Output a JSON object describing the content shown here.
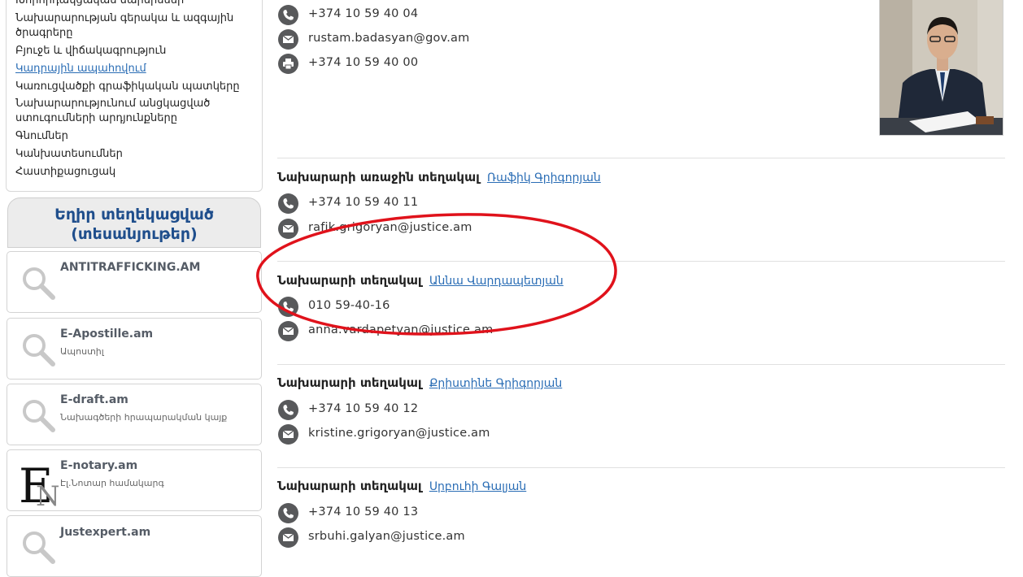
{
  "sidebar": {
    "menu": [
      "Խորհրդակցական մարմիններ",
      "Նախարարության գերակա և ազգային",
      "ծրագրերը",
      "Բյուջե և վիճակագրություն",
      "Կադրային ապահովում",
      "Կառուցվածքի գրաֆիկական պատկերը",
      "Նախարարությունում անցկացված",
      "ստուգումների արդյունքները",
      "Գնումներ",
      "Կանխատեսումներ",
      "Հաստիքացուցակ"
    ],
    "sites_heading_line1": "Եղիր տեղեկացված",
    "sites_heading_line2": "(տեսանյութեր)",
    "sites": [
      {
        "title": "ANTITRAFFICKING.AM",
        "sub": "",
        "icon": "search-icon"
      },
      {
        "title": "E-Apostille.am",
        "sub": "Ապոստիլ",
        "icon": "search-icon"
      },
      {
        "title": "E-draft.am",
        "sub": "Նախագծերի հրապարակման կայք",
        "icon": "search-icon"
      },
      {
        "title": "E-notary.am",
        "sub": "Էլ.Նոտար համակարգ",
        "icon": "en-logo"
      },
      {
        "title": "Justexpert.am",
        "sub": "",
        "icon": "search-icon"
      }
    ]
  },
  "contacts": {
    "minister": {
      "phone": "+374 10 59 40 04",
      "email": "rustam.badasyan@gov.am",
      "fax": "+374 10 59 40 00"
    },
    "deputies": [
      {
        "role": "Նախարարի առաջին տեղակալ",
        "name": "Ռաֆիկ Գրիգորյան",
        "phone": "+374 10 59 40 11",
        "email": "rafik.grigoryan@justice.am"
      },
      {
        "role": "Նախարարի տեղակալ",
        "name": "Աննա Վարդապետյան",
        "phone": "010 59-40-16",
        "email": "anna.vardapetyan@justice.am"
      },
      {
        "role": "Նախարարի տեղակալ",
        "name": "Քրիստինե Գրիգորյան",
        "phone": "+374 10 59 40 12",
        "email": "kristine.grigoryan@justice.am"
      },
      {
        "role": "Նախարարի տեղակալ",
        "name": "Սրբուհի Գալյան",
        "phone": "+374 10 59 40 13",
        "email": "srbuhi.galyan@justice.am"
      }
    ]
  },
  "colors": {
    "accent": "#2a6db5",
    "heading": "#1f4e8c",
    "annotation": "#e0121b",
    "icon_bg": "#58595b"
  }
}
